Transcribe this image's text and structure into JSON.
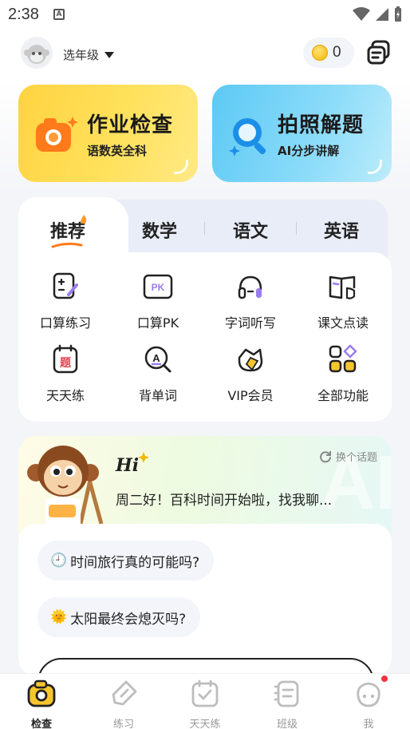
{
  "status_bar": {
    "time": "2:38",
    "notification_icon": "a-box-icon"
  },
  "header": {
    "grade_label": "选年级",
    "coin_count": "0"
  },
  "cards": {
    "homework_check": {
      "title": "作业检查",
      "subtitle": "语数英全科",
      "color": "#ffd341"
    },
    "photo_solve": {
      "title": "拍照解题",
      "subtitle": "AI分步讲解",
      "color": "#5cc9f4"
    }
  },
  "tabs": [
    {
      "label": "推荐"
    },
    {
      "label": "数学"
    },
    {
      "label": "语文"
    },
    {
      "label": "英语"
    }
  ],
  "features": [
    {
      "label": "口算练习",
      "icon": "oral-calc-icon"
    },
    {
      "label": "口算PK",
      "icon": "pk-icon"
    },
    {
      "label": "字词听写",
      "icon": "dictation-icon"
    },
    {
      "label": "课文点读",
      "icon": "read-book-icon"
    },
    {
      "label": "天天练",
      "icon": "daily-practice-icon"
    },
    {
      "label": "背单词",
      "icon": "vocab-icon"
    },
    {
      "label": "VIP会员",
      "icon": "vip-icon"
    },
    {
      "label": "全部功能",
      "icon": "all-features-icon"
    }
  ],
  "chat": {
    "hi": "Hi",
    "change_topic": "换个话题",
    "greeting": "周二好！百科时间开始啦，找我聊...",
    "topics": [
      {
        "emoji": "🕘",
        "text": "时间旅行真的可能吗?"
      },
      {
        "emoji": "🌞",
        "text": "太阳最终会熄灭吗?"
      }
    ]
  },
  "bottom_nav": [
    {
      "label": "检查",
      "active": true
    },
    {
      "label": "练习",
      "active": false
    },
    {
      "label": "天天练",
      "active": false
    },
    {
      "label": "班级",
      "active": false
    },
    {
      "label": "我",
      "active": false
    }
  ]
}
